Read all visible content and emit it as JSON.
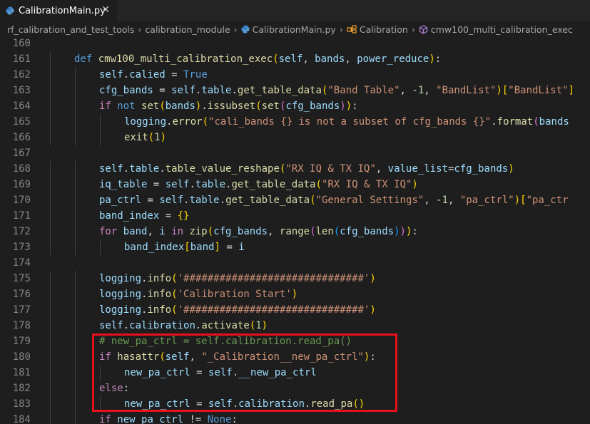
{
  "tab": {
    "filename": "CalibrationMain.py",
    "close_glyph": "✕"
  },
  "breadcrumb": {
    "items": [
      "rf_calibration_and_test_tools",
      "calibration_module",
      "CalibrationMain.py",
      "Calibration",
      "cmw100_multi_calibration_exec"
    ],
    "separator": "›"
  },
  "colors": {
    "keyword": "#569cd6",
    "control": "#c586c0",
    "function": "#dcdcaa",
    "variable": "#9cdcfe",
    "string": "#ce9178",
    "number": "#b5cea8",
    "comment": "#6a9955",
    "highlight": "#e8101c"
  },
  "editor": {
    "lines": [
      {
        "num": "160",
        "indent": 0,
        "tokens": []
      },
      {
        "num": "161",
        "indent": 1,
        "tokens": [
          [
            "def ",
            "k"
          ],
          [
            "cmw100_multi_calibration_exec",
            "f"
          ],
          [
            "(",
            "p1"
          ],
          [
            "self",
            "v"
          ],
          [
            ", ",
            ""
          ],
          [
            "bands",
            "v"
          ],
          [
            ", ",
            ""
          ],
          [
            "power_reduce",
            "v"
          ],
          [
            ")",
            "p1"
          ],
          [
            ":",
            ""
          ]
        ]
      },
      {
        "num": "162",
        "indent": 2,
        "tokens": [
          [
            "self",
            "v"
          ],
          [
            ".",
            ""
          ],
          [
            "calied",
            "v"
          ],
          [
            " = ",
            ""
          ],
          [
            "True",
            "k"
          ]
        ]
      },
      {
        "num": "163",
        "indent": 2,
        "tokens": [
          [
            "cfg_bands",
            "v"
          ],
          [
            " = ",
            ""
          ],
          [
            "self",
            "v"
          ],
          [
            ".",
            ""
          ],
          [
            "table",
            "v"
          ],
          [
            ".",
            ""
          ],
          [
            "get_table_data",
            "f"
          ],
          [
            "(",
            "p1"
          ],
          [
            "\"Band Table\"",
            "s"
          ],
          [
            ", -",
            ""
          ],
          [
            "1",
            "n"
          ],
          [
            ", ",
            ""
          ],
          [
            "\"BandList\"",
            "s"
          ],
          [
            ")",
            "p1"
          ],
          [
            "[",
            "p1"
          ],
          [
            "\"BandList\"",
            "s"
          ],
          [
            "]",
            "p1"
          ]
        ]
      },
      {
        "num": "164",
        "indent": 2,
        "tokens": [
          [
            "if ",
            "c"
          ],
          [
            "not ",
            "k"
          ],
          [
            "set",
            "f"
          ],
          [
            "(",
            "p1"
          ],
          [
            "bands",
            "v"
          ],
          [
            ")",
            "p1"
          ],
          [
            ".",
            ""
          ],
          [
            "issubset",
            "f"
          ],
          [
            "(",
            "p1"
          ],
          [
            "set",
            "f"
          ],
          [
            "(",
            "p2"
          ],
          [
            "cfg_bands",
            "v"
          ],
          [
            ")",
            "p2"
          ],
          [
            ")",
            "p1"
          ],
          [
            ":",
            ""
          ]
        ]
      },
      {
        "num": "165",
        "indent": 3,
        "tokens": [
          [
            "logging",
            "v"
          ],
          [
            ".",
            ""
          ],
          [
            "error",
            "f"
          ],
          [
            "(",
            "p1"
          ],
          [
            "\"cali_bands {} is not a subset of cfg_bands {}\"",
            "s"
          ],
          [
            ".",
            ""
          ],
          [
            "format",
            "f"
          ],
          [
            "(",
            "p2"
          ],
          [
            "bands",
            "v"
          ]
        ]
      },
      {
        "num": "166",
        "indent": 3,
        "tokens": [
          [
            "exit",
            "f"
          ],
          [
            "(",
            "p1"
          ],
          [
            "1",
            "n"
          ],
          [
            ")",
            "p1"
          ]
        ]
      },
      {
        "num": "167",
        "indent": 0,
        "tokens": []
      },
      {
        "num": "168",
        "indent": 2,
        "tokens": [
          [
            "self",
            "v"
          ],
          [
            ".",
            ""
          ],
          [
            "table",
            "v"
          ],
          [
            ".",
            ""
          ],
          [
            "table_value_reshape",
            "f"
          ],
          [
            "(",
            "p1"
          ],
          [
            "\"RX IQ & TX IQ\"",
            "s"
          ],
          [
            ", ",
            ""
          ],
          [
            "value_list",
            "v"
          ],
          [
            "=",
            ""
          ],
          [
            "cfg_bands",
            "v"
          ],
          [
            ")",
            "p1"
          ]
        ]
      },
      {
        "num": "169",
        "indent": 2,
        "tokens": [
          [
            "iq_table",
            "v"
          ],
          [
            " = ",
            ""
          ],
          [
            "self",
            "v"
          ],
          [
            ".",
            ""
          ],
          [
            "table",
            "v"
          ],
          [
            ".",
            ""
          ],
          [
            "get_table_data",
            "f"
          ],
          [
            "(",
            "p1"
          ],
          [
            "\"RX IQ & TX IQ\"",
            "s"
          ],
          [
            ")",
            "p1"
          ]
        ]
      },
      {
        "num": "170",
        "indent": 2,
        "tokens": [
          [
            "pa_ctrl",
            "v"
          ],
          [
            " = ",
            ""
          ],
          [
            "self",
            "v"
          ],
          [
            ".",
            ""
          ],
          [
            "table",
            "v"
          ],
          [
            ".",
            ""
          ],
          [
            "get_table_data",
            "f"
          ],
          [
            "(",
            "p1"
          ],
          [
            "\"General Settings\"",
            "s"
          ],
          [
            ", -",
            ""
          ],
          [
            "1",
            "n"
          ],
          [
            ", ",
            ""
          ],
          [
            "\"pa_ctrl\"",
            "s"
          ],
          [
            ")",
            "p1"
          ],
          [
            "[",
            "p1"
          ],
          [
            "\"pa_ctr",
            "s"
          ]
        ]
      },
      {
        "num": "171",
        "indent": 2,
        "tokens": [
          [
            "band_index",
            "v"
          ],
          [
            " = ",
            ""
          ],
          [
            "{}",
            "p1"
          ]
        ]
      },
      {
        "num": "172",
        "indent": 2,
        "tokens": [
          [
            "for ",
            "c"
          ],
          [
            "band",
            "v"
          ],
          [
            ", ",
            ""
          ],
          [
            "i ",
            "v"
          ],
          [
            "in ",
            "c"
          ],
          [
            "zip",
            "f"
          ],
          [
            "(",
            "p1"
          ],
          [
            "cfg_bands",
            "v"
          ],
          [
            ", ",
            ""
          ],
          [
            "range",
            "f"
          ],
          [
            "(",
            "p2"
          ],
          [
            "len",
            "f"
          ],
          [
            "(",
            "p3"
          ],
          [
            "cfg_bands",
            "v"
          ],
          [
            ")",
            "p3"
          ],
          [
            ")",
            "p2"
          ],
          [
            ")",
            "p1"
          ],
          [
            ":",
            ""
          ]
        ]
      },
      {
        "num": "173",
        "indent": 3,
        "tokens": [
          [
            "band_index",
            "v"
          ],
          [
            "[",
            "p1"
          ],
          [
            "band",
            "v"
          ],
          [
            "]",
            "p1"
          ],
          [
            " = ",
            ""
          ],
          [
            "i",
            "v"
          ]
        ]
      },
      {
        "num": "174",
        "indent": 0,
        "tokens": []
      },
      {
        "num": "175",
        "indent": 2,
        "tokens": [
          [
            "logging",
            "v"
          ],
          [
            ".",
            ""
          ],
          [
            "info",
            "f"
          ],
          [
            "(",
            "p1"
          ],
          [
            "'##############################'",
            "s"
          ],
          [
            ")",
            "p1"
          ]
        ]
      },
      {
        "num": "176",
        "indent": 2,
        "tokens": [
          [
            "logging",
            "v"
          ],
          [
            ".",
            ""
          ],
          [
            "info",
            "f"
          ],
          [
            "(",
            "p1"
          ],
          [
            "'Calibration Start'",
            "s"
          ],
          [
            ")",
            "p1"
          ]
        ]
      },
      {
        "num": "177",
        "indent": 2,
        "tokens": [
          [
            "logging",
            "v"
          ],
          [
            ".",
            ""
          ],
          [
            "info",
            "f"
          ],
          [
            "(",
            "p1"
          ],
          [
            "'##############################'",
            "s"
          ],
          [
            ")",
            "p1"
          ]
        ]
      },
      {
        "num": "178",
        "indent": 2,
        "tokens": [
          [
            "self",
            "v"
          ],
          [
            ".",
            ""
          ],
          [
            "calibration",
            "v"
          ],
          [
            ".",
            ""
          ],
          [
            "activate",
            "f"
          ],
          [
            "(",
            "p1"
          ],
          [
            "1",
            "n"
          ],
          [
            ")",
            "p1"
          ]
        ]
      },
      {
        "num": "179",
        "indent": 2,
        "tokens": [
          [
            "# new_pa_ctrl = self.calibration.read_pa()",
            "m"
          ]
        ]
      },
      {
        "num": "180",
        "indent": 2,
        "tokens": [
          [
            "if ",
            "c"
          ],
          [
            "hasattr",
            "f"
          ],
          [
            "(",
            "p1"
          ],
          [
            "self",
            "v"
          ],
          [
            ", ",
            ""
          ],
          [
            "\"_Calibration__new_pa_ctrl\"",
            "s"
          ],
          [
            ")",
            "p1"
          ],
          [
            ":",
            ""
          ]
        ]
      },
      {
        "num": "181",
        "indent": 3,
        "tokens": [
          [
            "new_pa_ctrl",
            "v"
          ],
          [
            " = ",
            ""
          ],
          [
            "self",
            "v"
          ],
          [
            ".",
            ""
          ],
          [
            "__new_pa_ctrl",
            "v"
          ]
        ]
      },
      {
        "num": "182",
        "indent": 2,
        "tokens": [
          [
            "else",
            "c"
          ],
          [
            ":",
            ""
          ]
        ]
      },
      {
        "num": "183",
        "indent": 3,
        "tokens": [
          [
            "new_pa_ctrl",
            "v"
          ],
          [
            " = ",
            ""
          ],
          [
            "self",
            "v"
          ],
          [
            ".",
            ""
          ],
          [
            "calibration",
            "v"
          ],
          [
            ".",
            ""
          ],
          [
            "read_pa",
            "f"
          ],
          [
            "(",
            "p1"
          ],
          [
            ")",
            "p1"
          ]
        ]
      },
      {
        "num": "184",
        "indent": 2,
        "tokens": [
          [
            "if ",
            "c"
          ],
          [
            "new_pa_ctrl",
            "v"
          ],
          [
            " != ",
            ""
          ],
          [
            "None",
            "k"
          ],
          [
            ":",
            ""
          ]
        ]
      }
    ]
  }
}
